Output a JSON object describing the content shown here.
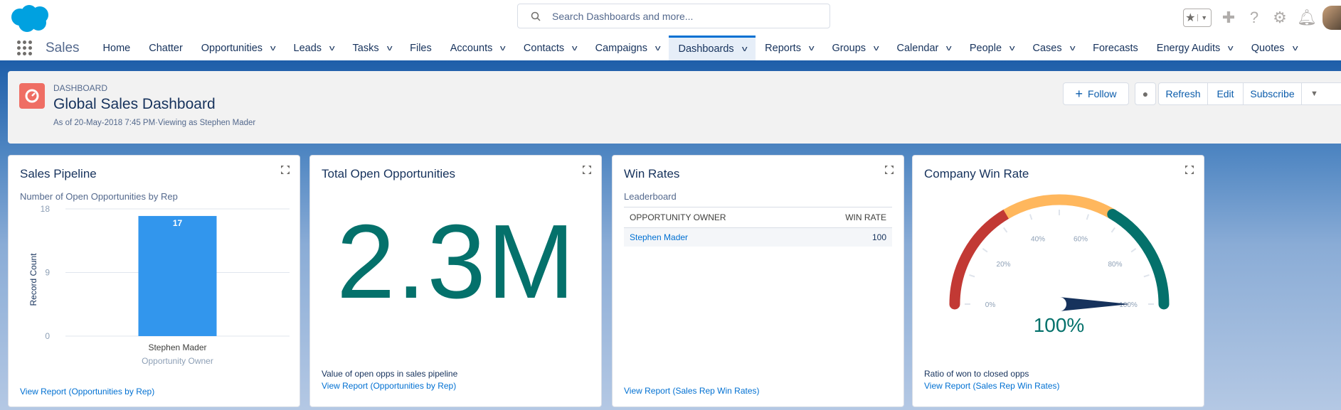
{
  "header": {
    "search_placeholder": "Search Dashboards and more..."
  },
  "nav": {
    "app_name": "Sales",
    "items": [
      {
        "label": "Home",
        "chev": false
      },
      {
        "label": "Chatter",
        "chev": false
      },
      {
        "label": "Opportunities",
        "chev": true
      },
      {
        "label": "Leads",
        "chev": true
      },
      {
        "label": "Tasks",
        "chev": true
      },
      {
        "label": "Files",
        "chev": false
      },
      {
        "label": "Accounts",
        "chev": true
      },
      {
        "label": "Contacts",
        "chev": true
      },
      {
        "label": "Campaigns",
        "chev": true
      },
      {
        "label": "Dashboards",
        "chev": true,
        "active": true
      },
      {
        "label": "Reports",
        "chev": true
      },
      {
        "label": "Groups",
        "chev": true
      },
      {
        "label": "Calendar",
        "chev": true
      },
      {
        "label": "People",
        "chev": true
      },
      {
        "label": "Cases",
        "chev": true
      },
      {
        "label": "Forecasts",
        "chev": false
      },
      {
        "label": "Energy Audits",
        "chev": true
      },
      {
        "label": "Quotes",
        "chev": true
      }
    ]
  },
  "dashboard": {
    "label": "DASHBOARD",
    "title": "Global Sales Dashboard",
    "subtitle": "As of 20-May-2018 7:45 PM·Viewing as Stephen Mader",
    "buttons": {
      "follow": "Follow",
      "refresh": "Refresh",
      "edit": "Edit",
      "subscribe": "Subscribe"
    }
  },
  "cards": {
    "pipeline": {
      "title": "Sales Pipeline",
      "subtitle": "Number of Open Opportunities by Rep",
      "link": "View Report (Opportunities by Rep)"
    },
    "open": {
      "title": "Total Open Opportunities",
      "value": "2.3M",
      "footer": "Value of open opps in sales pipeline",
      "link": "View Report (Opportunities by Rep)"
    },
    "win": {
      "title": "Win Rates",
      "subtitle": "Leaderboard",
      "columns": [
        "OPPORTUNITY OWNER",
        "WIN RATE"
      ],
      "rows": [
        [
          "Stephen Mader",
          "100"
        ]
      ],
      "link": "View Report (Sales Rep Win Rates)"
    },
    "company": {
      "title": "Company Win Rate",
      "value_label": "100%",
      "footer": "Ratio of won to closed opps",
      "link": "View Report (Sales Rep Win Rates)"
    }
  },
  "chart_data": [
    {
      "type": "bar",
      "categories": [
        "Stephen Mader"
      ],
      "values": [
        17
      ],
      "xlabel": "Opportunity Owner",
      "ylabel": "Record Count",
      "ylim": [
        0,
        18
      ],
      "yticks": [
        "0",
        "9",
        "18"
      ],
      "color": "#3296ed"
    },
    {
      "type": "gauge",
      "value": 100,
      "range": [
        0,
        100
      ],
      "tick_labels": [
        "0%",
        "20%",
        "40%",
        "60%",
        "80%",
        "100%"
      ],
      "bands": [
        {
          "from": 0,
          "to": 33,
          "color": "#c23934"
        },
        {
          "from": 33,
          "to": 67,
          "color": "#ffb75d"
        },
        {
          "from": 67,
          "to": 100,
          "color": "#04716b"
        }
      ],
      "value_color": "#04716b"
    }
  ]
}
